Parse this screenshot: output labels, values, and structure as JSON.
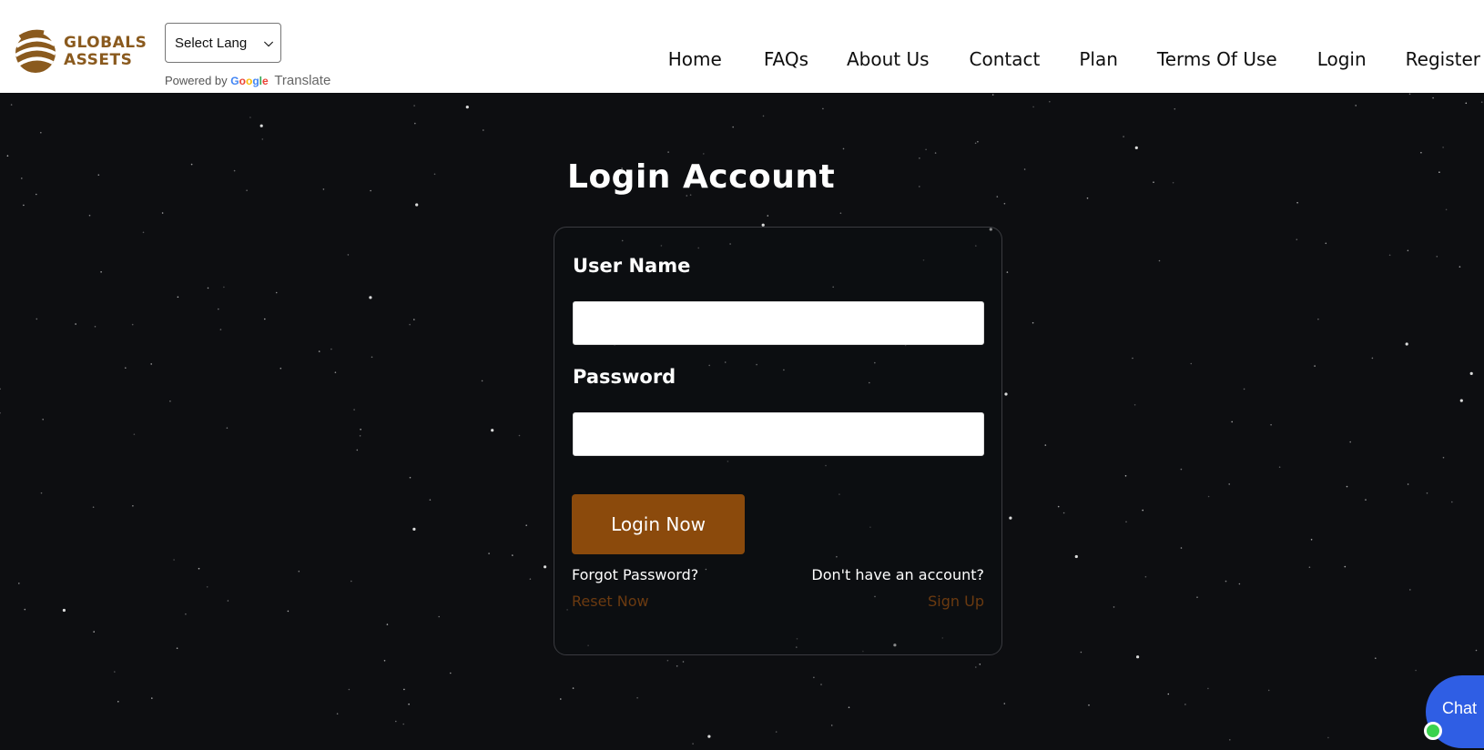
{
  "brand": {
    "name_line1": "GLOBALS",
    "name_line2": "ASSETS",
    "color": "#8a5a1e"
  },
  "translate": {
    "select_value": "Select Lang",
    "powered_by": "Powered by",
    "google": "Google",
    "translate_word": "Translate"
  },
  "nav": {
    "items": [
      {
        "label": "Home"
      },
      {
        "label": "FAQs"
      },
      {
        "label": "About Us"
      },
      {
        "label": "Contact"
      },
      {
        "label": "Plan"
      },
      {
        "label": "Terms Of Use"
      },
      {
        "label": "Login"
      },
      {
        "label": "Register"
      }
    ]
  },
  "login": {
    "title": "Login Account",
    "username_label": "User Name",
    "username_value": "",
    "password_label": "Password",
    "password_value": "",
    "submit_label": "Login Now",
    "forgot_text": "Forgot Password?",
    "reset_link": "Reset Now",
    "no_account_text": "Don't have an account?",
    "signup_link": "Sign Up"
  },
  "chat": {
    "label": "Chat"
  },
  "colors": {
    "background": "#0d0e11",
    "accent": "#8b4a0c",
    "link": "#6b3a10",
    "chat": "#2f5ee4",
    "online": "#3ad24e"
  }
}
